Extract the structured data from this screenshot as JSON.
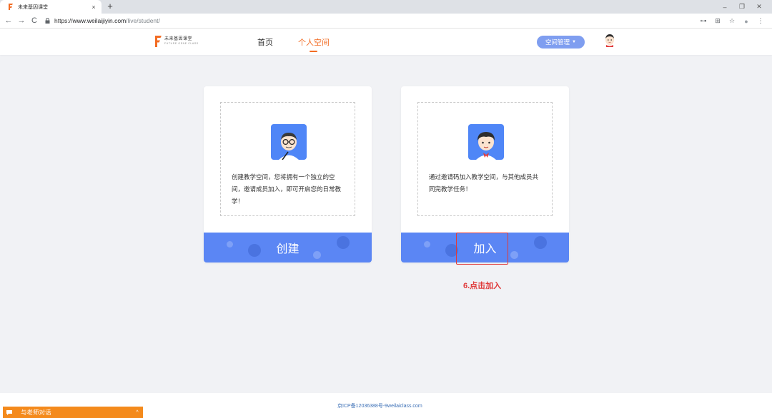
{
  "browser": {
    "tab_title": "未来基因课堂",
    "tab_close": "×",
    "new_tab": "+",
    "win_min": "–",
    "win_restore": "❐",
    "win_close": "✕",
    "back": "←",
    "forward": "→",
    "reload": "C",
    "url_scheme": "https://",
    "url_host": "www.weilaijiyin.com",
    "url_path": "/live/student/",
    "key_icon": "⊶",
    "translate_icon": "⊞",
    "star_icon": "☆",
    "profile_icon": "●",
    "menu_icon": "⋮"
  },
  "header": {
    "logo_cn": "未来基因课堂",
    "logo_en": "FUTURE GENE CLASS",
    "nav": [
      {
        "label": "首页"
      },
      {
        "label": "个人空间"
      }
    ],
    "space_mgmt": "空间管理",
    "space_mgmt_caret": "▼",
    "accent_color": "#f26c24"
  },
  "cards": [
    {
      "desc": "创建教学空间，您将拥有一个独立的空间，邀请成员加入，即可开启您的日常教学！",
      "button": "创建"
    },
    {
      "desc": "通过邀请码加入教学空间，与其他成员共同完教学任务！",
      "button": "加入"
    }
  ],
  "annotation": {
    "step_note": "6.点击加入",
    "color": "#e03a3a"
  },
  "footer": {
    "icp": "京ICP备12036388号-9weilaiclass.com"
  },
  "chat": {
    "label": "与老师对话",
    "toggle": "^"
  }
}
